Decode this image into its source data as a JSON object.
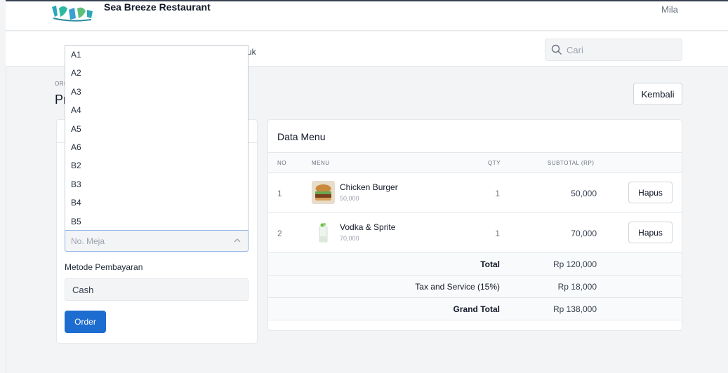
{
  "header": {
    "brand": "Sea Breeze Restaurant",
    "user": "Mila"
  },
  "nav": {
    "visible_fragment": "uk"
  },
  "search": {
    "placeholder": "Cari"
  },
  "page": {
    "breadcrumb": "ORD",
    "title": "Pr",
    "back_label": "Kembali"
  },
  "order_form": {
    "table_options": [
      "A1",
      "A2",
      "A3",
      "A4",
      "A5",
      "A6",
      "B2",
      "B3",
      "B4",
      "B5"
    ],
    "table_placeholder": "No. Meja",
    "payment_label": "Metode Pembayaran",
    "payment_value": "Cash",
    "order_label": "Order"
  },
  "menu_table": {
    "title": "Data Menu",
    "columns": [
      "NO",
      "MENU",
      "QTY",
      "SUBTOTAL (RP)"
    ],
    "rows": [
      {
        "no": "1",
        "name": "Chicken Burger",
        "price": "50,000",
        "qty": "1",
        "subtotal": "50,000",
        "action": "Hapus"
      },
      {
        "no": "2",
        "name": "Vodka & Sprite",
        "price": "70,000",
        "qty": "1",
        "subtotal": "70,000",
        "action": "Hapus"
      }
    ],
    "summary": [
      {
        "label": "Total",
        "value": "Rp 120,000",
        "bold": true
      },
      {
        "label": "Tax and Service (15%)",
        "value": "Rp 18,000",
        "bold": false
      },
      {
        "label": "Grand Total",
        "value": "Rp 138,000",
        "bold": true
      }
    ]
  },
  "colors": {
    "primary": "#1d6ccf",
    "focus_border": "#93b4e8"
  },
  "icons": {
    "search": "search-icon",
    "chevron": "chevron-up-icon",
    "logo": "brand-logo"
  }
}
